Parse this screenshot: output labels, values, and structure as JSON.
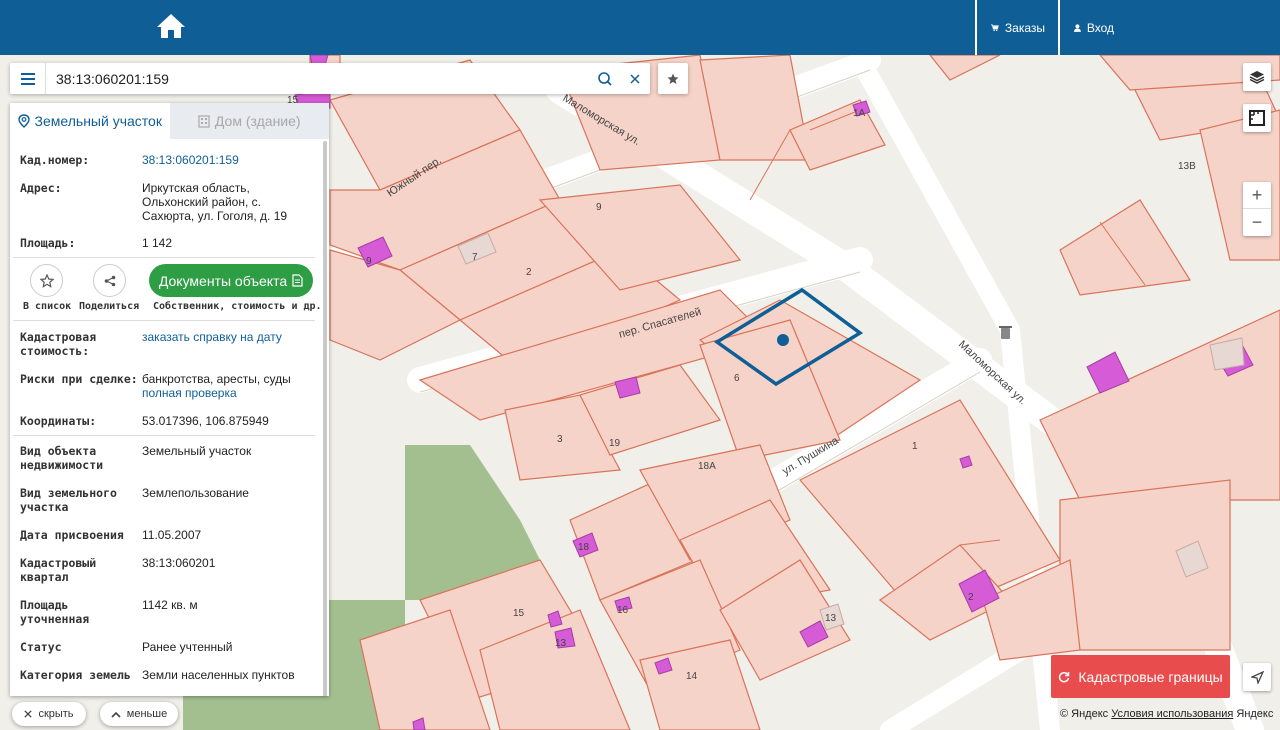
{
  "header": {
    "orders_label": "Заказы",
    "login_label": "Вход"
  },
  "search": {
    "value": "38:13:060201:159"
  },
  "panel": {
    "tabs": [
      {
        "label": "Земельный участок"
      },
      {
        "label": "Дом (здание)"
      }
    ],
    "cad_number": {
      "label": "Кад.номер:",
      "value": "38:13:060201:159"
    },
    "address": {
      "label": "Адрес:",
      "value": "Иркутская область, Ольхонский район, с. Сахюрта, ул. Гоголя, д. 19"
    },
    "area": {
      "label": "Площадь:",
      "value": "1 142"
    },
    "actions": {
      "to_list": "В список",
      "share": "Поделиться",
      "documents": "Документы объекта",
      "documents_sub": "Собственник, стоимость и др."
    },
    "cad_cost": {
      "label": "Кадастровая стоимость:",
      "value": "заказать справку на дату"
    },
    "risks": {
      "label": "Риски при сделке:",
      "value": "банкротства, аресты, суды",
      "link": "полная проверка"
    },
    "coords": {
      "label": "Координаты:",
      "value": "53.017396, 106.875949"
    },
    "object_type": {
      "label": "Вид объекта недвижимости",
      "value": "Земельный участок"
    },
    "land_type": {
      "label": "Вид земельного участка",
      "value": "Землепользование"
    },
    "assign_date": {
      "label": "Дата присвоения",
      "value": "11.05.2007"
    },
    "quarter": {
      "label": "Кадастровый квартал",
      "value": "38:13:060201"
    },
    "area_precise": {
      "label": "Площадь уточненная",
      "value": "1142 кв. м"
    },
    "status": {
      "label": "Статус",
      "value": "Ранее учтенный"
    },
    "land_category": {
      "label": "Категория земель",
      "value": "Земли населенных пунктов"
    }
  },
  "bottom": {
    "hide_label": "скрыть",
    "less_label": "меньше"
  },
  "map": {
    "cad_borders_label": "Кадастровые границы",
    "copyright": "© Яндекс",
    "terms": "Условия использования",
    "yandex": "Яндекс",
    "streets": {
      "malomorskaya1": "Маломорская ул.",
      "malomorskaya2": "Маломорская ул.",
      "yuzhny": "Южный пер.",
      "spasateley": "пер. Спасателей",
      "pushkina": "ул. Пушкина"
    },
    "numbers": [
      "15",
      "9",
      "7",
      "2",
      "9",
      "6",
      "3",
      "19",
      "18А",
      "1",
      "13В",
      "18",
      "15",
      "16",
      "13",
      "13",
      "14",
      "2",
      "1А"
    ]
  },
  "colors": {
    "header": "#0f5f96",
    "parcel_fill": "#f6d3c8",
    "parcel_stroke": "#d9735a",
    "building": "#d65bd6",
    "selected": "#0f5f96",
    "docs_button": "#2e9e45",
    "cad_button": "#e84c4c"
  }
}
